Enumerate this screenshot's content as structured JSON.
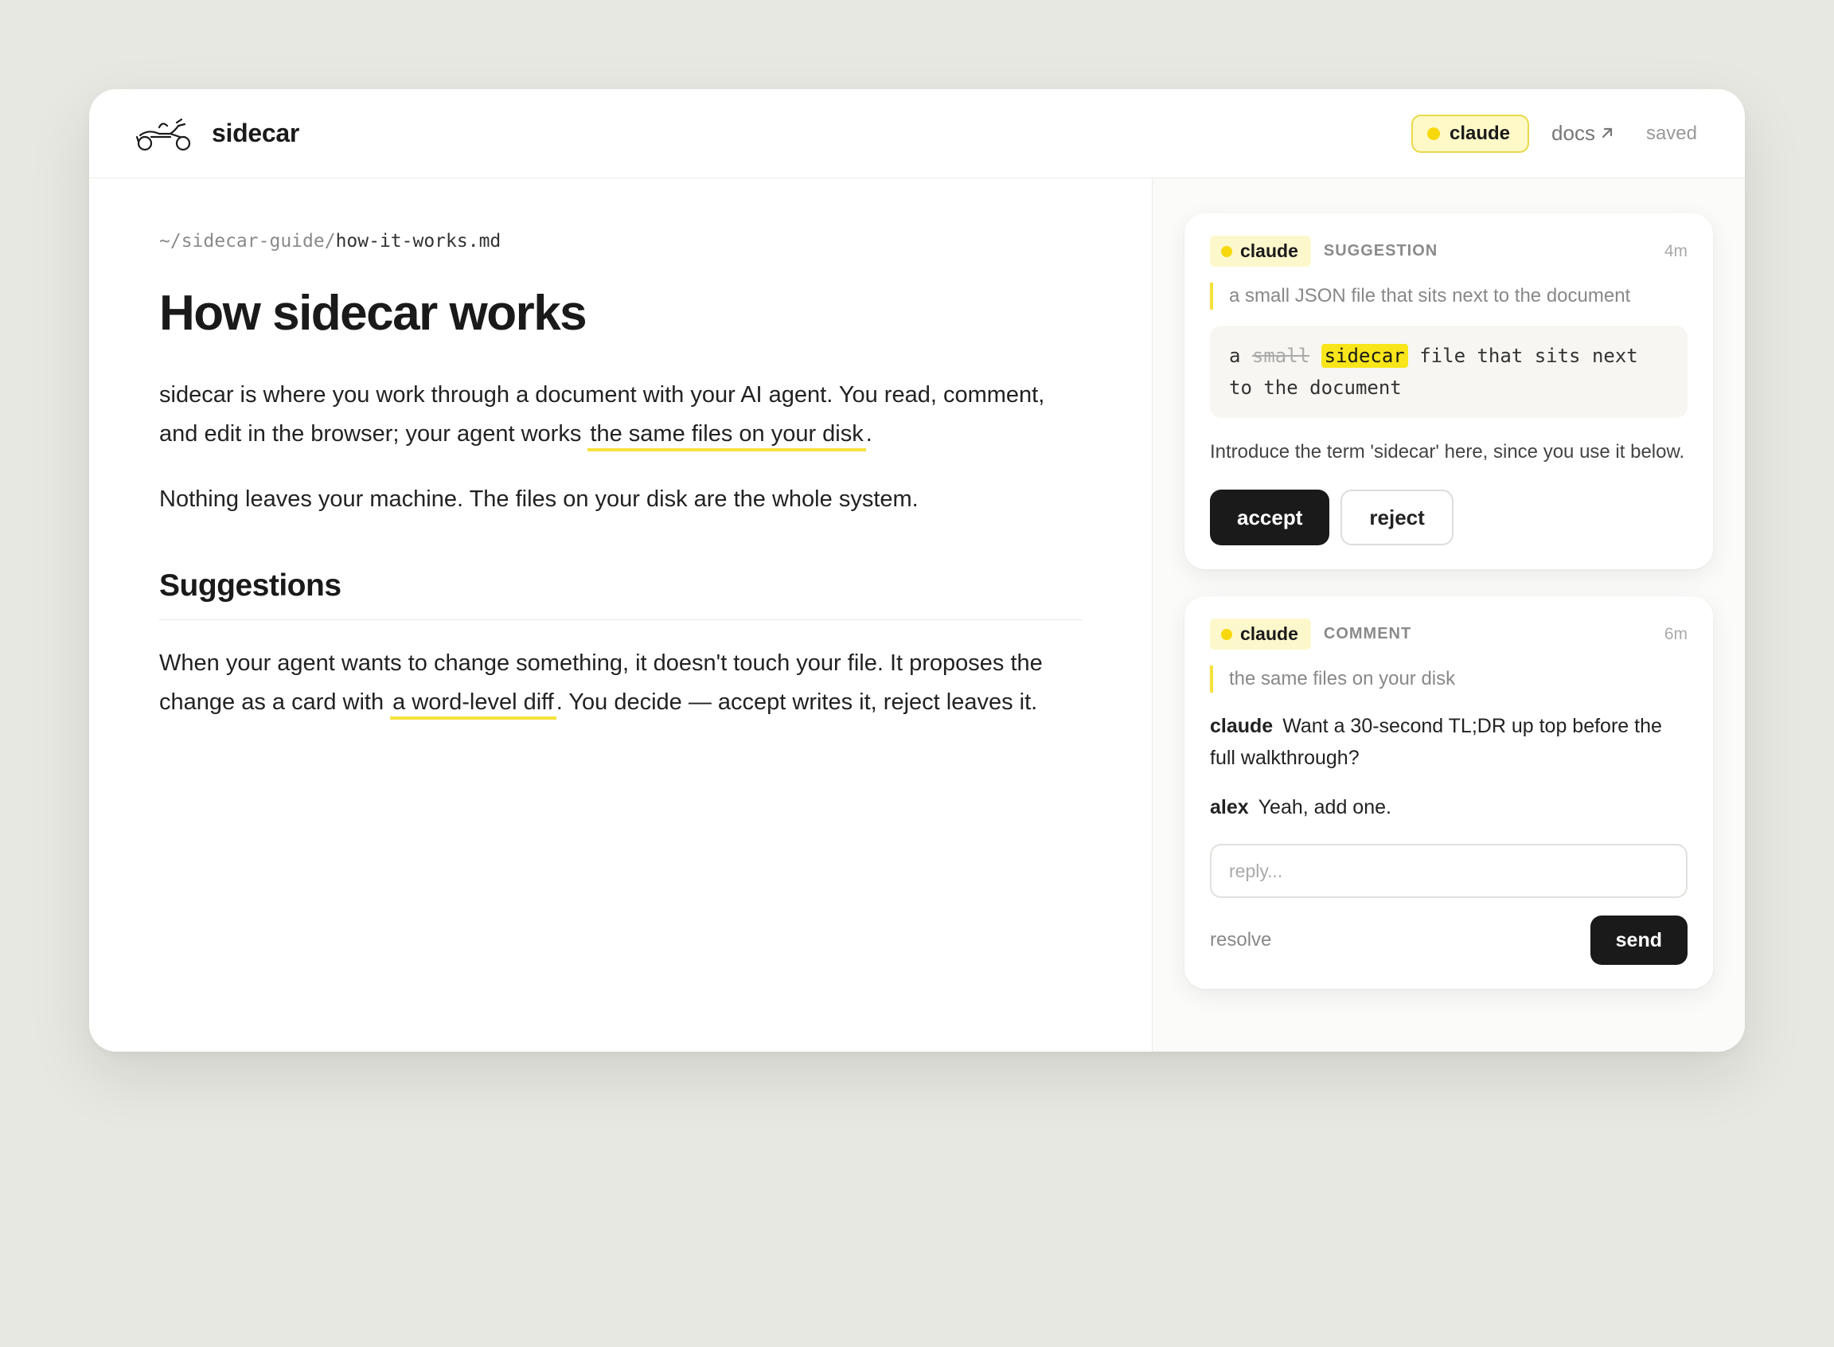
{
  "app": {
    "title": "sidecar"
  },
  "topbar": {
    "agent_label": "claude",
    "docs_label": "docs",
    "status": "saved"
  },
  "doc": {
    "breadcrumb_dir": "~/sidecar-guide/",
    "breadcrumb_file": "how-it-works.md",
    "title": "How sidecar works",
    "p1_a": "sidecar is where you work through a document with your AI agent. You read, comment, and edit in the browser; your agent works ",
    "p1_hl": "the same files on your disk",
    "p1_b": ".",
    "p2": "Nothing leaves your machine. The files on your disk are the whole system.",
    "h2": "Suggestions",
    "p3_a": "When your agent wants to change something, it doesn't touch your file. It proposes the change as a card with ",
    "p3_hl": "a word-level diff",
    "p3_b": ". You decide — accept writes it, reject leaves it."
  },
  "suggestion_card": {
    "agent": "claude",
    "kind": "SUGGESTION",
    "time": "4m",
    "quote": "a small JSON file that sits next to the document",
    "diff_pre": "a ",
    "diff_del": "small",
    "diff_ins": "sidecar",
    "diff_post": " file that sits next to the document",
    "body": "Introduce the term 'sidecar' here, since you use it below.",
    "accept_label": "accept",
    "reject_label": "reject"
  },
  "comment_card": {
    "agent": "claude",
    "kind": "COMMENT",
    "time": "6m",
    "quote": "the same files on your disk",
    "messages": [
      {
        "author": "claude",
        "text": "Want a 30-second TL;DR up top before the full walkthrough?"
      },
      {
        "author": "alex",
        "text": "Yeah, add one."
      }
    ],
    "reply_placeholder": "reply...",
    "resolve_label": "resolve",
    "send_label": "send"
  }
}
